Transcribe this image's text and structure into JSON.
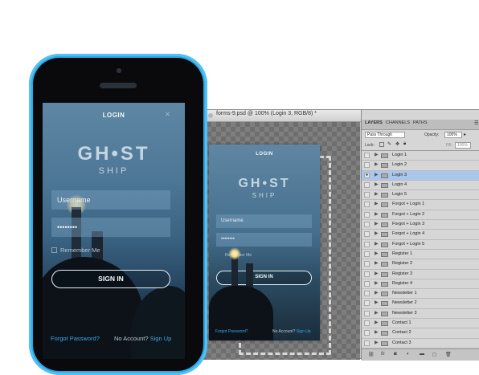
{
  "app": {
    "login_title": "LOGIN",
    "close_symbol": "×",
    "logo_main": "GH•ST",
    "logo_sub": "SHIP",
    "username_placeholder": "Username",
    "password_value": "••••••••",
    "remember_label": "Remember Me",
    "signin_label": "SIGN IN",
    "forgot_link": "Forgot Password?",
    "no_account_text": "No Account?",
    "signup_link": "Sign Up"
  },
  "photoshop": {
    "document_title": "forms-9.psd @ 100% (Login 3, RGB/8) *",
    "panel_tabs": [
      "LAYERS",
      "CHANNELS",
      "PATHS"
    ],
    "blend_mode": "Pass Through",
    "opacity_label": "Opacity:",
    "opacity_value": "100%",
    "lock_label": "Lock:",
    "fill_label": "Fill:",
    "fill_value": "100%",
    "layers": [
      {
        "name": "Login 1",
        "selected": false,
        "visible": false
      },
      {
        "name": "Login 2",
        "selected": false,
        "visible": false
      },
      {
        "name": "Login 3",
        "selected": true,
        "visible": true
      },
      {
        "name": "Login 4",
        "selected": false,
        "visible": false
      },
      {
        "name": "Login 5",
        "selected": false,
        "visible": false
      },
      {
        "name": "Forgot + Login 1",
        "selected": false,
        "visible": false
      },
      {
        "name": "Forgot + Login 2",
        "selected": false,
        "visible": false
      },
      {
        "name": "Forgot + Login 3",
        "selected": false,
        "visible": false
      },
      {
        "name": "Forgot + Login 4",
        "selected": false,
        "visible": false
      },
      {
        "name": "Forgot + Login 5",
        "selected": false,
        "visible": false
      },
      {
        "name": "Register 1",
        "selected": false,
        "visible": false
      },
      {
        "name": "Register 2",
        "selected": false,
        "visible": false
      },
      {
        "name": "Register 3",
        "selected": false,
        "visible": false
      },
      {
        "name": "Register 4",
        "selected": false,
        "visible": false
      },
      {
        "name": "Newsletter 1",
        "selected": false,
        "visible": false
      },
      {
        "name": "Newsletter 2",
        "selected": false,
        "visible": false
      },
      {
        "name": "Newsletter 3",
        "selected": false,
        "visible": false
      },
      {
        "name": "Contact 1",
        "selected": false,
        "visible": false
      },
      {
        "name": "Contact 2",
        "selected": false,
        "visible": false
      },
      {
        "name": "Contact 3",
        "selected": false,
        "visible": false
      }
    ]
  },
  "colors": {
    "phone_body": "#29a8e6",
    "link_blue": "#39a9e8",
    "layer_selected": "#a9c6ec"
  }
}
